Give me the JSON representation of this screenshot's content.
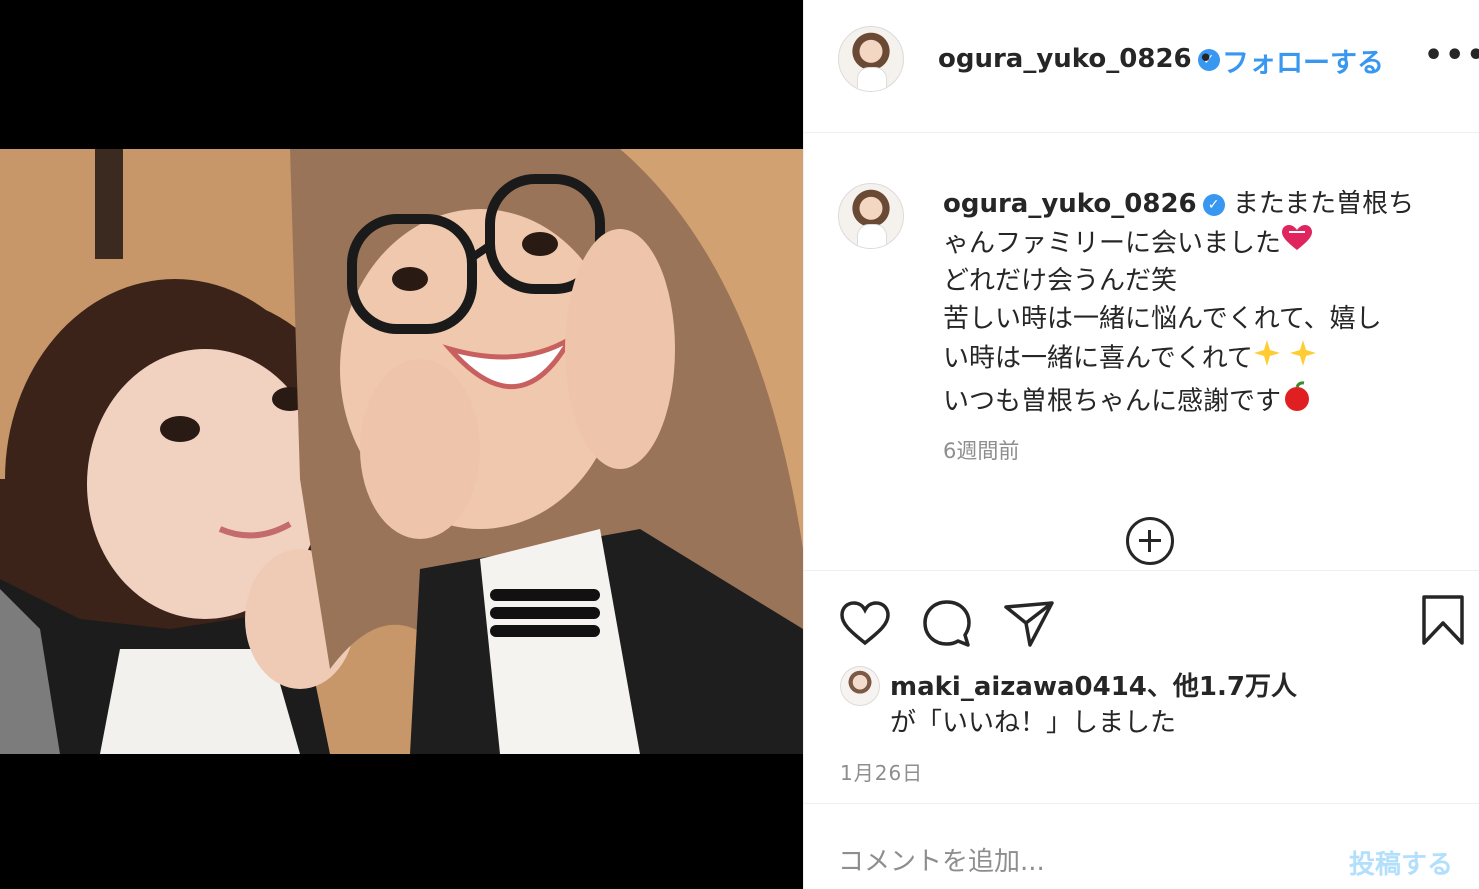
{
  "post": {
    "username": "ogura_yuko_0826",
    "verified_icon": "verified-badge-icon",
    "separator": "•",
    "follow_label": "フォローする",
    "more_label": "•••"
  },
  "caption": {
    "username": "ogura_yuko_0826",
    "line1": "またまた曽根ち",
    "line2": "ゃんファミリーに会いました",
    "line3": "どれだけ会うんだ笑",
    "line4": "苦しい時は一緒に悩んでくれて、嬉し",
    "line5": "い時は一緒に喜んでくれて",
    "line6": "いつも曽根ちゃんに感謝です",
    "time_ago": "6週間前"
  },
  "icons": {
    "heart": "heart-icon",
    "comment": "comment-icon",
    "share": "share-icon",
    "save": "bookmark-icon",
    "load_more": "plus-circle-icon",
    "emoji1": "heart-emoji",
    "emoji2": "sparkles-emoji",
    "emoji3": "apple-emoji"
  },
  "likes": {
    "liker": "maki_aizawa0414",
    "others": "、他1.7万人",
    "suffix": "が「いいね！」しました"
  },
  "date": "1月26日",
  "comment_box": {
    "placeholder": "コメントを追加...",
    "post_label": "投稿する"
  },
  "colors": {
    "accent": "#3897f0",
    "muted": "#8e8e8e",
    "post_disabled": "#b2dffc"
  }
}
